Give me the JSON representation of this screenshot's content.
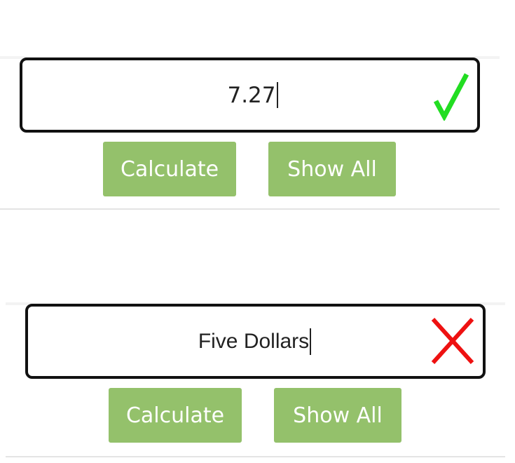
{
  "form_valid": {
    "amount_value": "7.27",
    "status": "valid",
    "status_icon": "checkmark-icon",
    "status_color": "#22dd22",
    "calculate_label": "Calculate",
    "show_all_label": "Show All"
  },
  "form_invalid": {
    "amount_value": "Five Dollars",
    "status": "invalid",
    "status_icon": "cross-icon",
    "status_color": "#ee1111",
    "calculate_label": "Calculate",
    "show_all_label": "Show All"
  },
  "colors": {
    "button_bg": "#94c16b",
    "button_text": "#ffffff",
    "input_border": "#111111"
  }
}
